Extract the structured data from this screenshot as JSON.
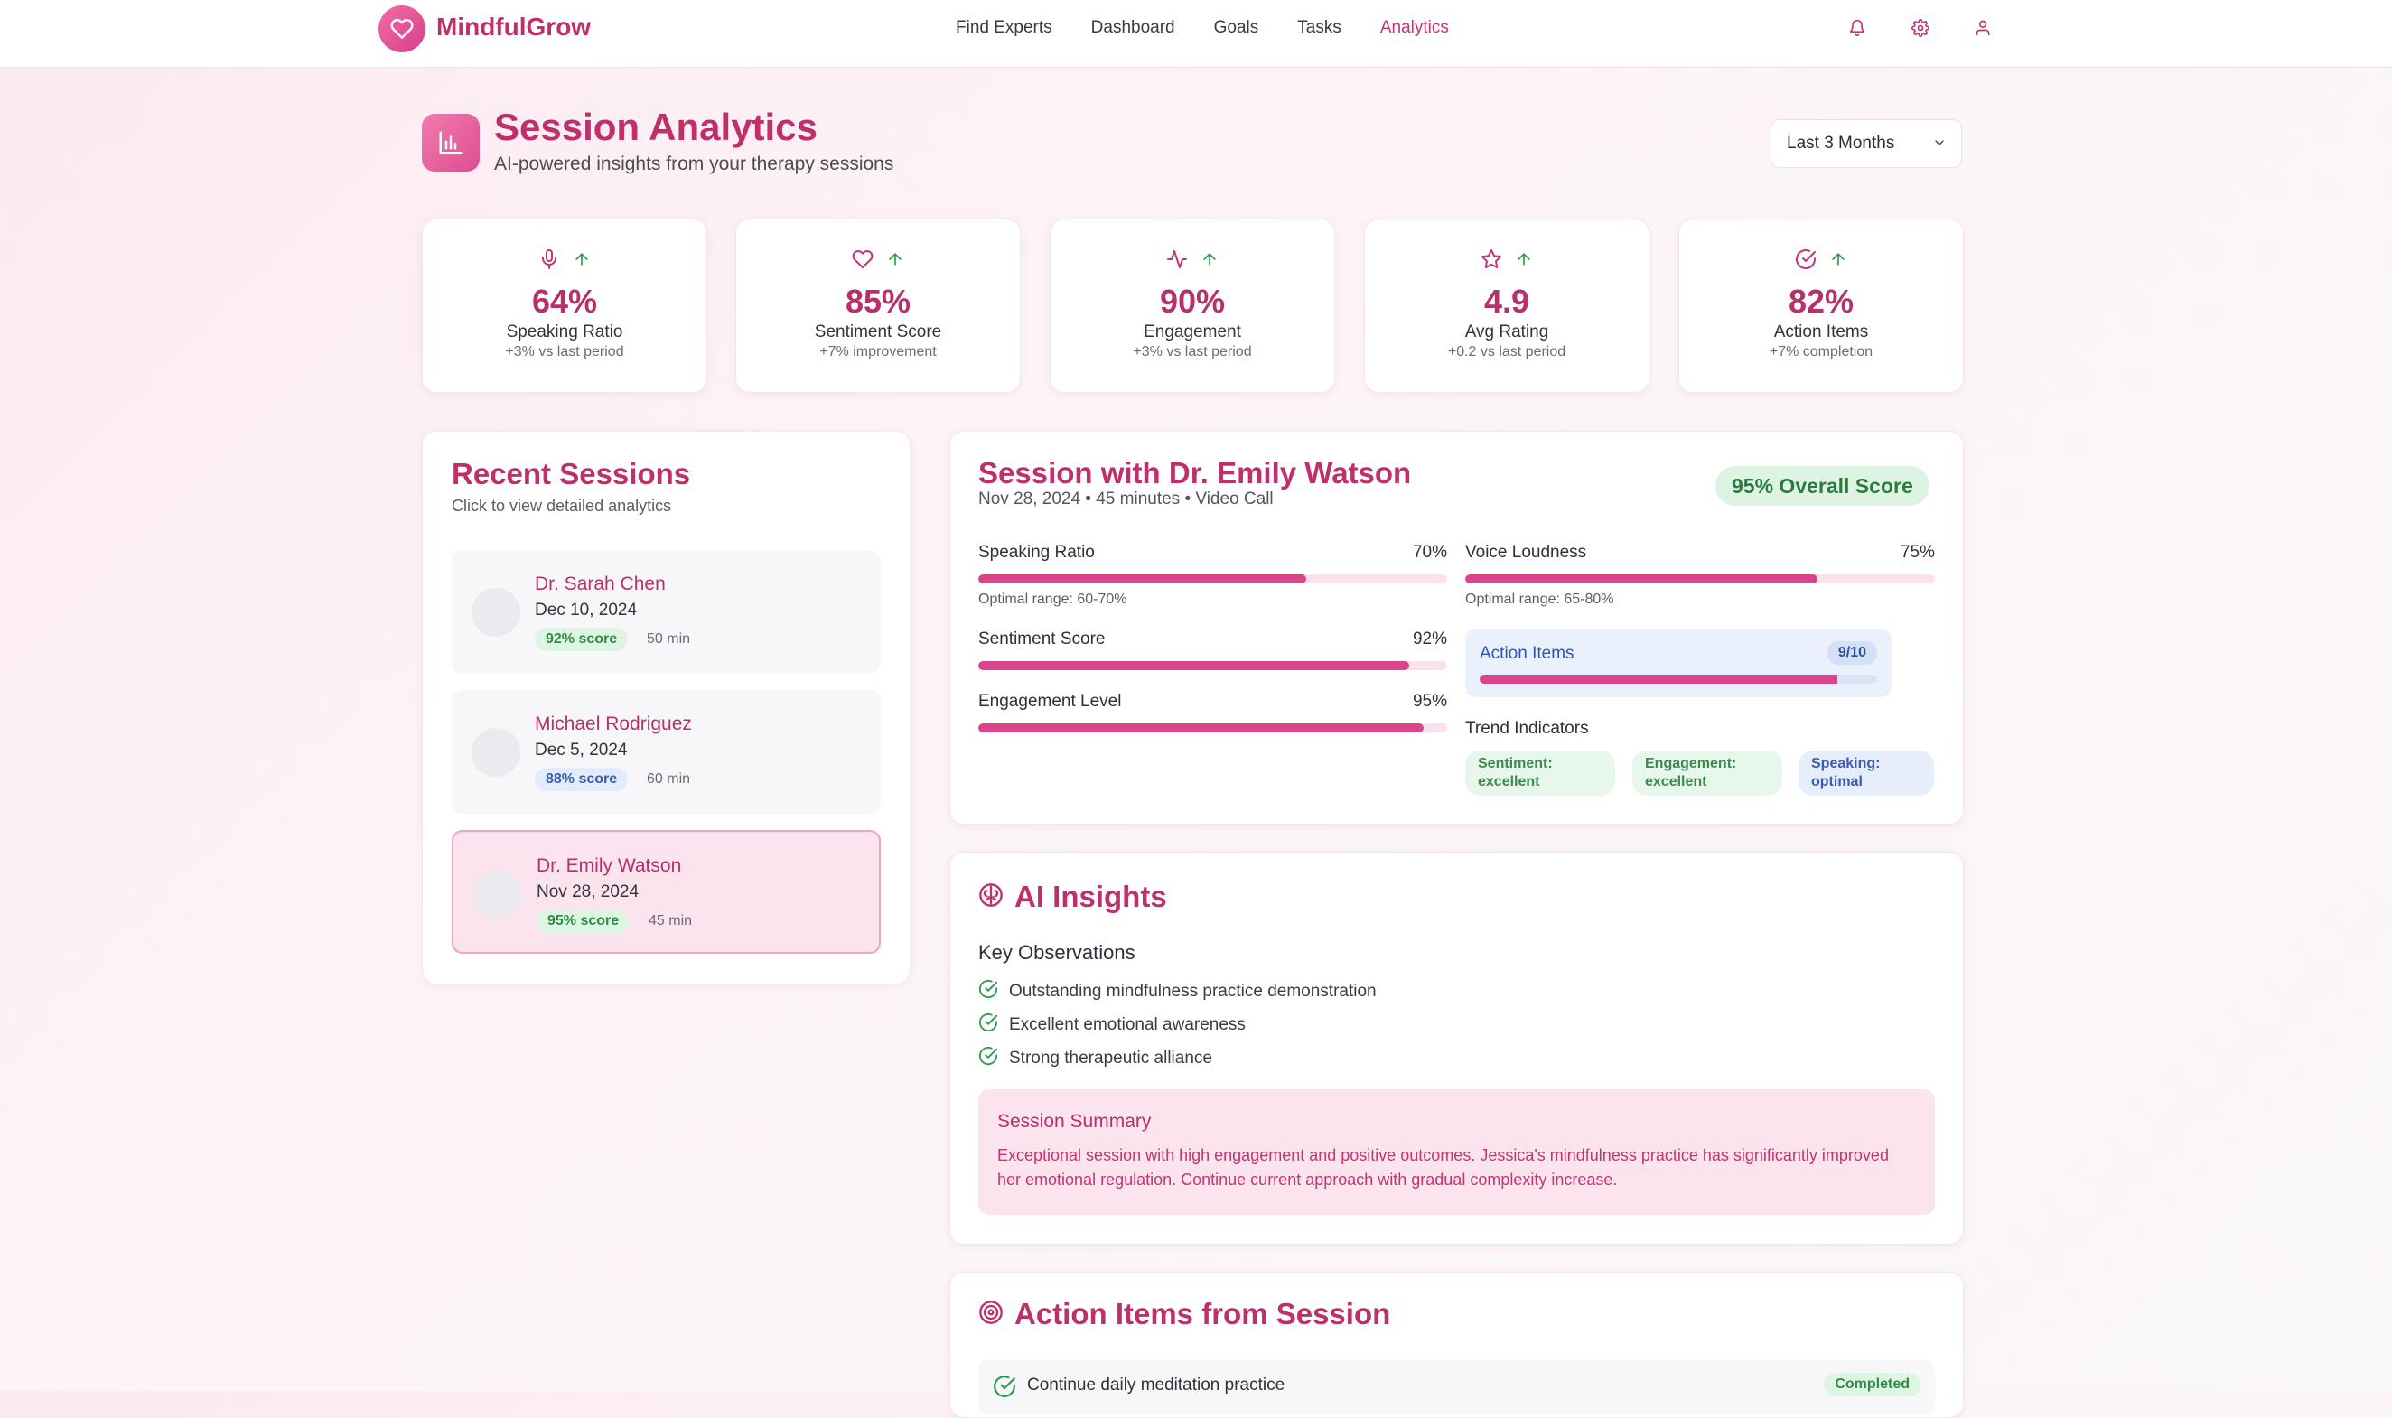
{
  "brand": {
    "name": "MindfulGrow"
  },
  "nav": {
    "links": [
      "Find Experts",
      "Dashboard",
      "Goals",
      "Tasks",
      "Analytics"
    ],
    "active": "Analytics",
    "icons": [
      "bell-icon",
      "gear-icon",
      "user-icon"
    ]
  },
  "header": {
    "title": "Session Analytics",
    "subtitle": "AI-powered insights from your therapy sessions",
    "range": "Last 3 Months"
  },
  "stats": [
    {
      "icon": "mic-icon",
      "value": "64%",
      "label": "Speaking Ratio",
      "sub": "+3% vs last period"
    },
    {
      "icon": "heart-icon",
      "value": "85%",
      "label": "Sentiment Score",
      "sub": "+7% improvement"
    },
    {
      "icon": "activity-icon",
      "value": "90%",
      "label": "Engagement",
      "sub": "+3% vs last period"
    },
    {
      "icon": "star-icon",
      "value": "4.9",
      "label": "Avg Rating",
      "sub": "+0.2 vs last period"
    },
    {
      "icon": "check-circle-icon",
      "value": "82%",
      "label": "Action Items",
      "sub": "+7% completion"
    }
  ],
  "recent": {
    "title": "Recent Sessions",
    "subtitle": "Click to view detailed analytics",
    "sessions": [
      {
        "name": "Dr. Sarah Chen",
        "date": "Dec 10, 2024",
        "score": "92% score",
        "duration": "50 min"
      },
      {
        "name": "Michael Rodriguez",
        "date": "Dec 5, 2024",
        "score": "88% score",
        "duration": "60 min"
      },
      {
        "name": "Dr. Emily Watson",
        "date": "Nov 28, 2024",
        "score": "95% score",
        "duration": "45 min"
      }
    ]
  },
  "detail": {
    "title": "Session with Dr. Emily Watson",
    "meta": "Nov 28, 2024 • 45 minutes • Video Call",
    "overall": "95% Overall Score",
    "metrics": {
      "speaking": {
        "label": "Speaking Ratio",
        "value": "70%",
        "note": "Optimal range: 60-70%",
        "level": 0.7
      },
      "voice": {
        "label": "Voice Loudness",
        "value": "75%",
        "note": "Optimal range: 65-80%",
        "level": 0.75
      },
      "sentiment": {
        "label": "Sentiment Score",
        "value": "92%",
        "level": 0.92
      },
      "engagement": {
        "label": "Engagement Level",
        "value": "95%",
        "level": 0.95
      }
    },
    "action_items": {
      "label": "Action Items",
      "count": "9/10",
      "level": 0.9
    },
    "trend_title": "Trend Indicators",
    "trends": [
      "Sentiment: excellent",
      "Engagement: excellent",
      "Speaking: optimal"
    ]
  },
  "insights": {
    "title": "AI Insights",
    "observations_title": "Key Observations",
    "observations": [
      "Outstanding mindfulness practice demonstration",
      "Excellent emotional awareness",
      "Strong therapeutic alliance"
    ],
    "summary_title": "Session Summary",
    "summary_body": "Exceptional session with high engagement and positive outcomes. Jessica's mindfulness practice has significantly improved her emotional regulation. Continue current approach with gradual complexity increase."
  },
  "actions": {
    "title": "Action Items from Session",
    "items": [
      {
        "text": "Continue daily meditation practice",
        "status": "Completed"
      }
    ]
  },
  "colors": {
    "accent": "#bf2f6c",
    "bar": "#d9458a",
    "success": "#2f8a45",
    "info": "#3b5bb0"
  }
}
